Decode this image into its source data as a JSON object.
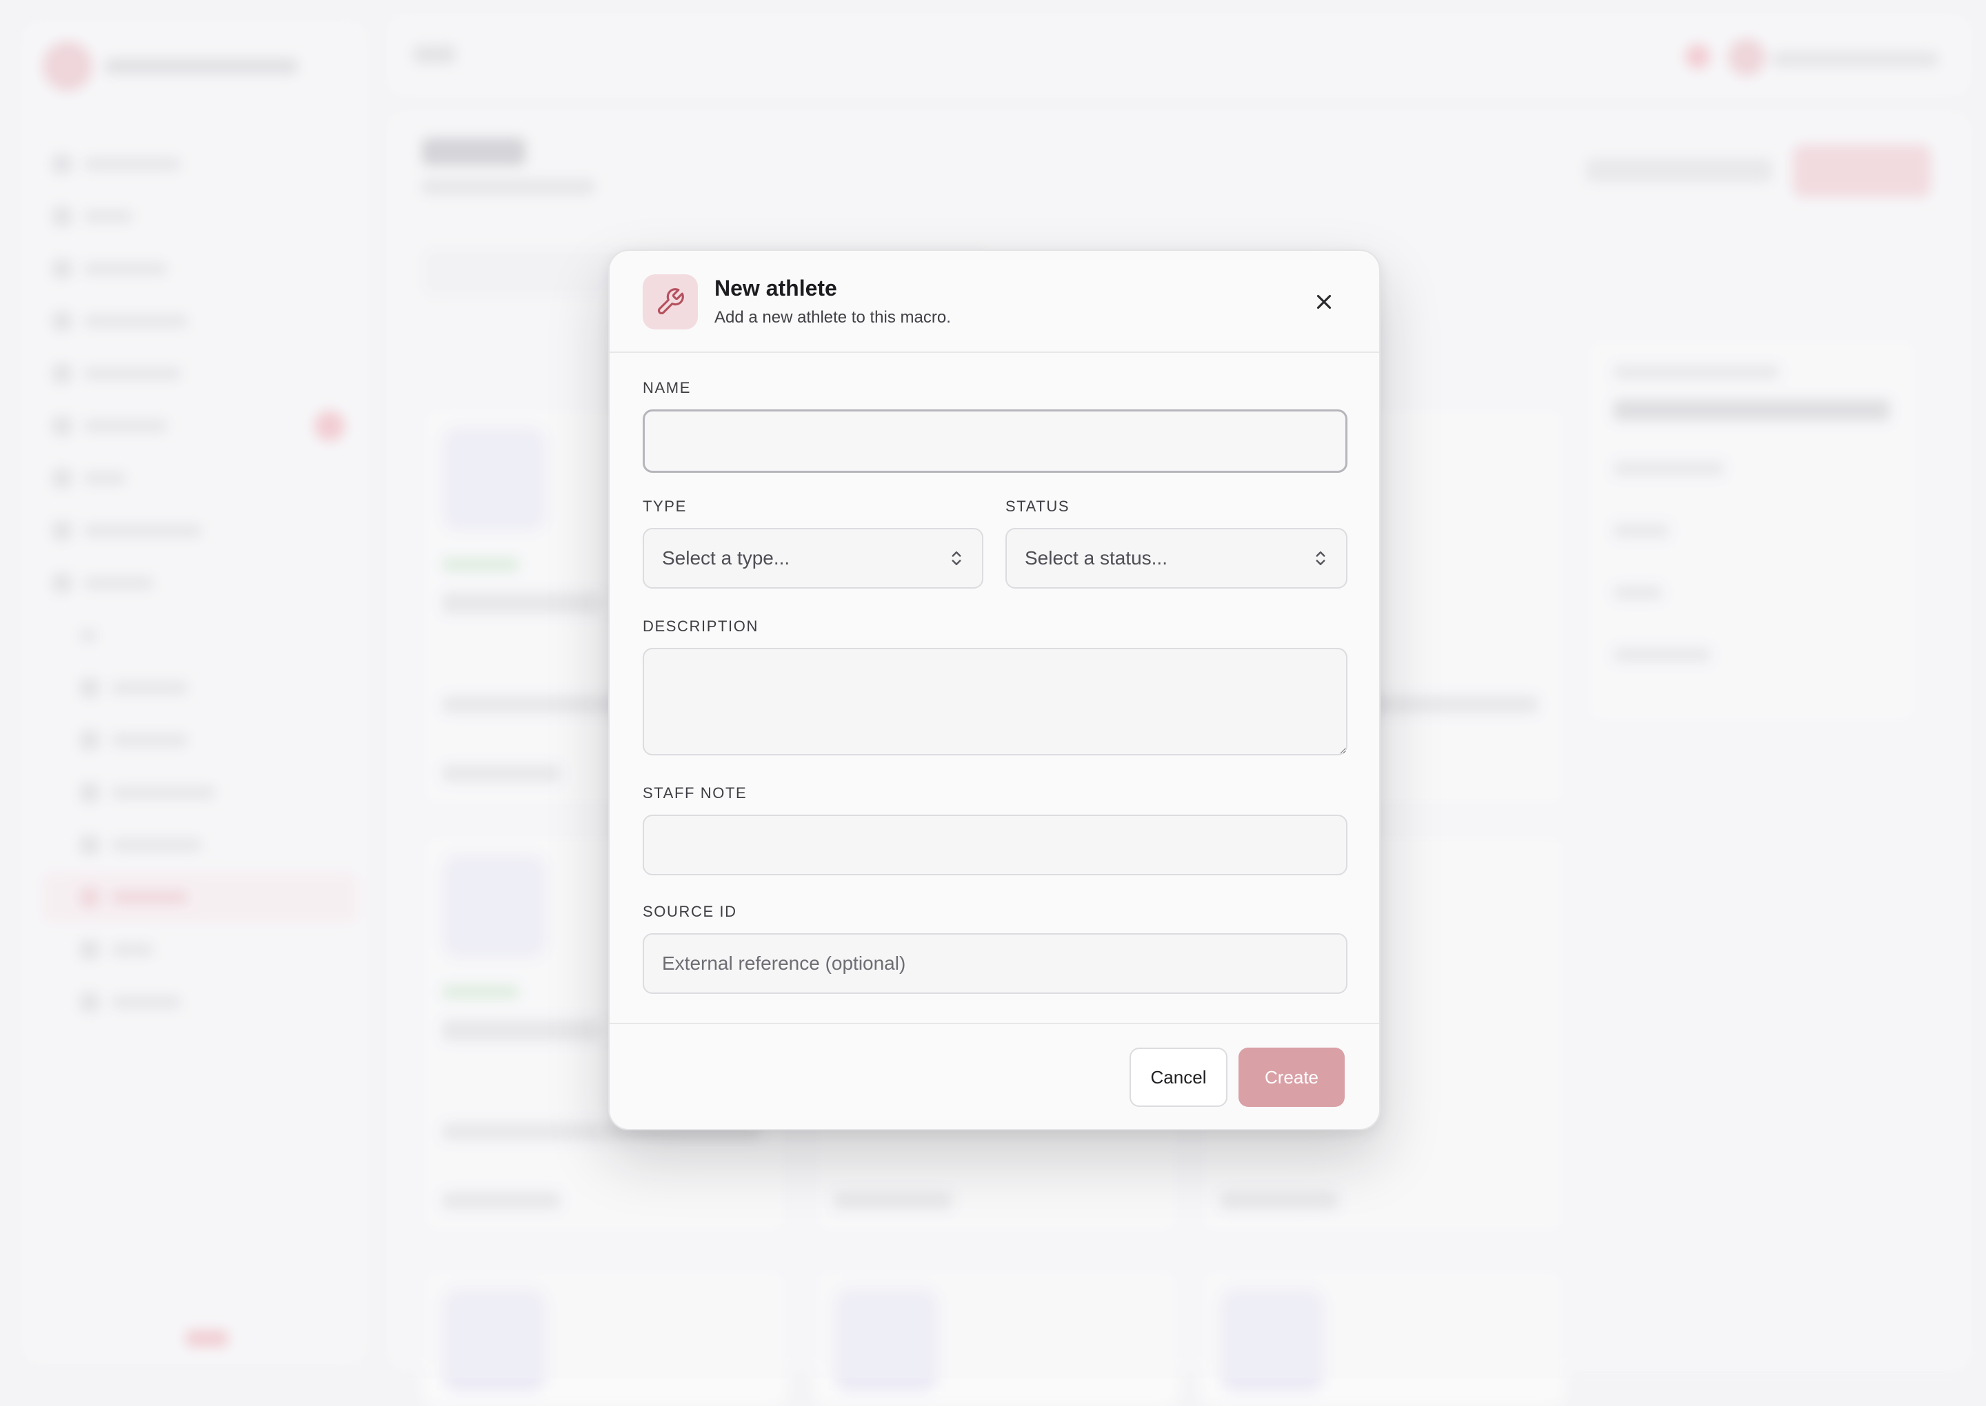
{
  "modal": {
    "title": "New athlete",
    "subtitle": "Add a new athlete to this macro.",
    "icon": "wrench-icon",
    "close_icon": "close-icon",
    "fields": {
      "name": {
        "label": "NAME",
        "value": "",
        "placeholder": ""
      },
      "type": {
        "label": "TYPE",
        "placeholder": "Select a type..."
      },
      "status": {
        "label": "STATUS",
        "placeholder": "Select a status..."
      },
      "description": {
        "label": "DESCRIPTION",
        "value": "",
        "placeholder": ""
      },
      "staff_note": {
        "label": "STAFF NOTE",
        "value": "",
        "placeholder": ""
      },
      "source_id": {
        "label": "SOURCE ID",
        "value": "",
        "placeholder": "External reference (optional)"
      }
    },
    "buttons": {
      "cancel": "Cancel",
      "create": "Create"
    }
  },
  "colors": {
    "accent": "#d9a0a6",
    "icon_bg": "#f2dcdf",
    "icon_stroke": "#b5515f"
  }
}
